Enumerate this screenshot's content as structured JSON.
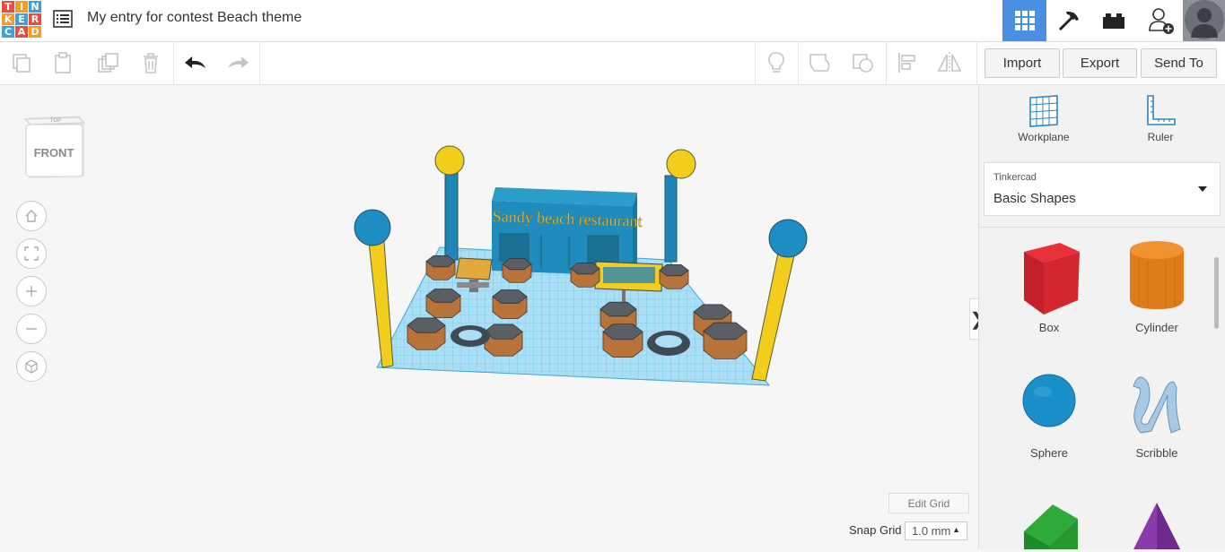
{
  "app": {
    "logo_letters": [
      "T",
      "I",
      "N",
      "K",
      "E",
      "R",
      "C",
      "A",
      "D"
    ],
    "logo_colors": [
      "#e94d3f",
      "#f59b26",
      "#3d9ee0",
      "#f59b26",
      "#3d9ee0",
      "#e94d3f",
      "#3d9ee0",
      "#e94d3f",
      "#f59b26"
    ],
    "title": "My entry for contest Beach theme"
  },
  "header": {
    "icons": [
      "grid-icon",
      "pickaxe-icon",
      "bricks-icon",
      "add-user-icon",
      "avatar"
    ],
    "accent": "#4a90e2"
  },
  "toolbar": {
    "import_label": "Import",
    "export_label": "Export",
    "send_to_label": "Send To"
  },
  "viewport": {
    "viewcube_top": "TOP",
    "viewcube_front": "FRONT",
    "sign_text": "Sandy beach restaurant",
    "edit_grid_label": "Edit Grid",
    "snap_grid_label": "Snap Grid",
    "snap_grid_value": "1.0 mm"
  },
  "panel": {
    "workplane_label": "Workplane",
    "ruler_label": "Ruler",
    "category": "Tinkercad",
    "library": "Basic Shapes",
    "shapes": [
      {
        "label": "Box"
      },
      {
        "label": "Cylinder"
      },
      {
        "label": "Sphere"
      },
      {
        "label": "Scribble"
      }
    ]
  }
}
